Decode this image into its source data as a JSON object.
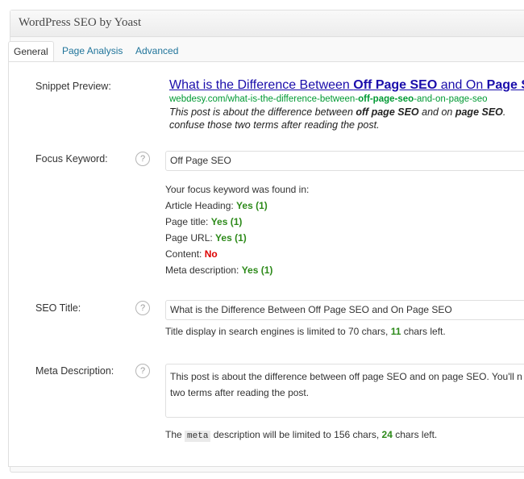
{
  "metabox": {
    "title": "WordPress SEO by Yoast"
  },
  "tabs": [
    {
      "label": "General",
      "active": true
    },
    {
      "label": "Page Analysis",
      "active": false
    },
    {
      "label": "Advanced",
      "active": false
    }
  ],
  "snippet": {
    "label": "Snippet Preview:",
    "title_pre": "What is the Difference Between ",
    "title_kw1": "Off Page SEO",
    "title_mid": " and On ",
    "title_kw2": "Page S",
    "url_pre": "webdesy.com/what-is-the-difference-between-",
    "url_kw": "off-page-seo",
    "url_post": "-and-on-page-seo",
    "desc_pre": "This post is about the difference between ",
    "desc_kw1": "off page SEO",
    "desc_mid": " and on ",
    "desc_kw2": "page SEO",
    "desc_post": ". ",
    "desc_line2": "confuse those two terms after reading the post."
  },
  "focus_keyword": {
    "label": "Focus Keyword:",
    "help": "?",
    "value": "Off Page SEO",
    "found_intro": "Your focus keyword was found in:",
    "checks": [
      {
        "label": "Article Heading: ",
        "result": "Yes (1)",
        "status": "good"
      },
      {
        "label": "Page title: ",
        "result": "Yes (1)",
        "status": "good"
      },
      {
        "label": "Page URL: ",
        "result": "Yes (1)",
        "status": "good"
      },
      {
        "label": "Content: ",
        "result": "No",
        "status": "bad"
      },
      {
        "label": "Meta description: ",
        "result": "Yes (1)",
        "status": "good"
      }
    ]
  },
  "seo_title": {
    "label": "SEO Title:",
    "help": "?",
    "value": "What is the Difference Between Off Page SEO and On Page SEO",
    "note_pre": "Title display in search engines is limited to 70 chars, ",
    "chars_left": "11",
    "note_post": " chars left."
  },
  "meta_description": {
    "label": "Meta Description:",
    "help": "?",
    "line1": "This post is about the difference between off page SEO and on page SEO. You'll n",
    "line2": "two terms after reading the post.",
    "note_pre": "The ",
    "note_code": "meta",
    "note_mid": " description will be limited to 156 chars, ",
    "chars_left": "24",
    "note_post": " chars left."
  },
  "colors": {
    "link": "#21759b",
    "good": "#2d8a1a",
    "bad": "#dd0000",
    "url": "#009933"
  }
}
